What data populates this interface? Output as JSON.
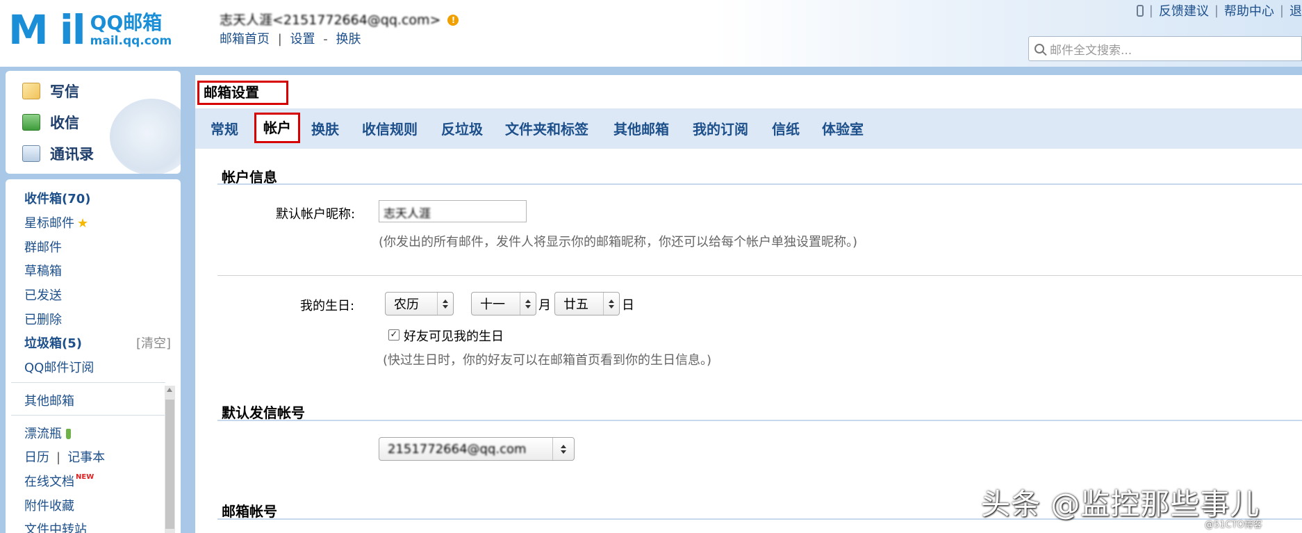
{
  "logo": {
    "mark": "M il",
    "brand": "QQ邮箱",
    "url": "mail.qq.com"
  },
  "header": {
    "user": "志天人涯<2151772664@qq.com>",
    "links": [
      "邮箱首页",
      "设置",
      "换肤"
    ],
    "links_sep": "|",
    "links_dash": "-",
    "top_links": [
      "反馈建议",
      "帮助中心",
      "退"
    ],
    "top_sep": "|",
    "search_placeholder": "邮件全文搜索..."
  },
  "sidebar": {
    "quick": [
      {
        "label": "写信",
        "icon": "write-icon"
      },
      {
        "label": "收信",
        "icon": "inbox-download-icon"
      },
      {
        "label": "通讯录",
        "icon": "contacts-icon"
      }
    ],
    "folders": [
      {
        "label": "收件箱(70)"
      },
      {
        "label": "星标邮件"
      },
      {
        "label": "群邮件"
      },
      {
        "label": "草稿箱"
      },
      {
        "label": "已发送"
      },
      {
        "label": "已删除"
      },
      {
        "label": "垃圾箱(5)"
      },
      {
        "label": "QQ邮件订阅"
      }
    ],
    "clear_label": "[清空]",
    "other_mailbox": "其他邮箱",
    "apps": {
      "drift_bottle": "漂流瓶",
      "calendar": "日历",
      "notebook": "记事本",
      "apps_sep": "|",
      "docs": "在线文档",
      "new_badge": "NEW",
      "attachments": "附件收藏",
      "transfer": "文件中转站"
    }
  },
  "main": {
    "title": "邮箱设置",
    "tabs": [
      "常规",
      "帐户",
      "换肤",
      "收信规则",
      "反垃圾",
      "文件夹和标签",
      "其他邮箱",
      "我的订阅",
      "信纸",
      "体验室"
    ],
    "active_tab": "帐户",
    "account_info": {
      "section_title": "帐户信息",
      "nickname_label": "默认帐户昵称:",
      "nickname_value": "志天人涯",
      "nickname_hint": "(你发出的所有邮件，发件人将显示你的邮箱昵称，你还可以给每个帐户单独设置昵称。)",
      "birthday_label": "我的生日:",
      "calendar_type": "农历",
      "month": "十一",
      "month_unit": "月",
      "day": "廿五",
      "day_unit": "日",
      "friends_visible_label": "好友可见我的生日",
      "friends_visible_checked": true,
      "birthday_hint": "(快过生日时，你的好友可以在邮箱首页看到你的生日信息。)"
    },
    "default_sender": {
      "section_title": "默认发信帐号",
      "value": "2151772664@qq.com"
    },
    "mailbox_accounts": {
      "section_title": "邮箱帐号"
    }
  },
  "watermark": {
    "text": "头条 @监控那些事儿",
    "small": "@51CTO博客"
  },
  "colors": {
    "link": "#1d4f8a",
    "frame": "#a9c8e8",
    "tabbar": "#dce8f6",
    "highlight": "#d60000"
  }
}
